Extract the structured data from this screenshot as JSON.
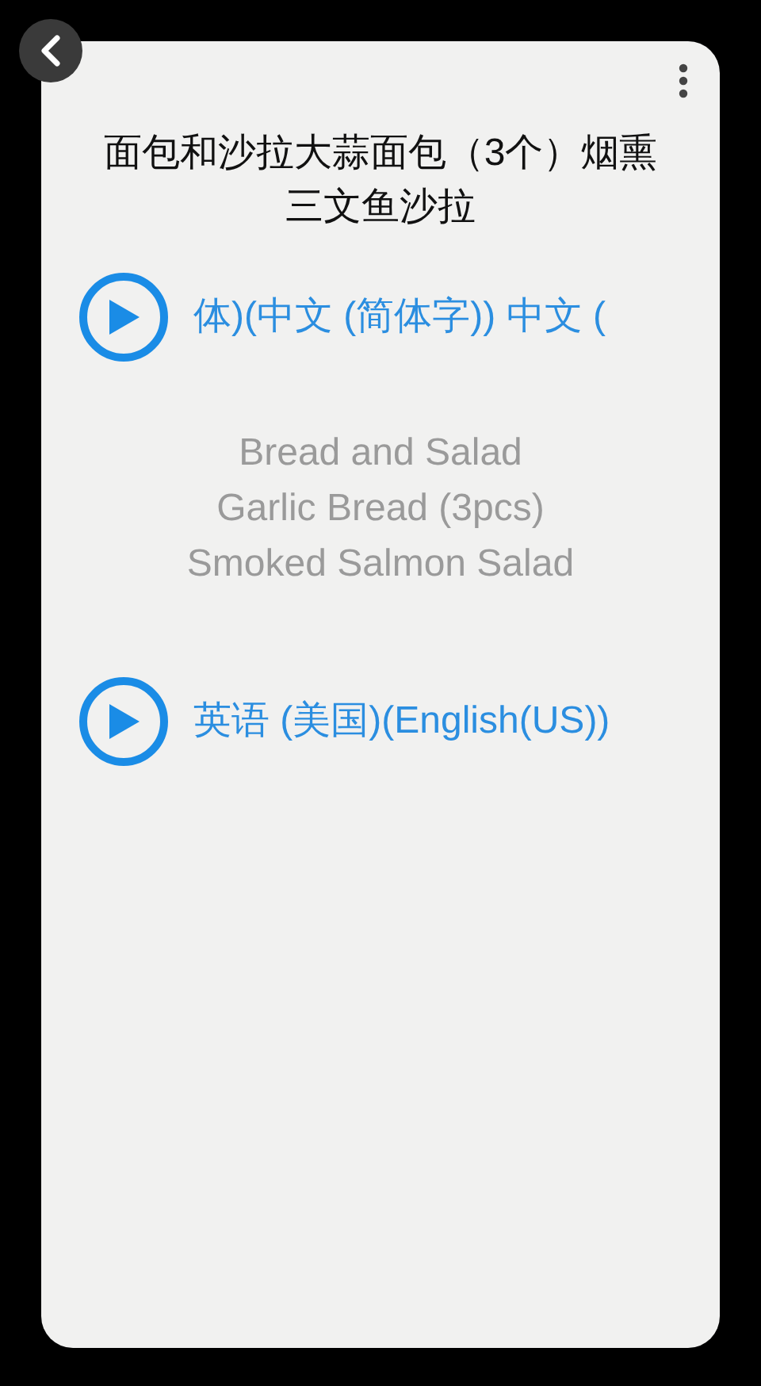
{
  "title": "面包和沙拉大蒜面包（3个）烟熏三文鱼沙拉",
  "players": [
    {
      "label": "体)(中文 (简体字))  中文 ("
    },
    {
      "label": "英语 (美国)(English(US))"
    }
  ],
  "translation_lines": [
    "Bread and Salad",
    "Garlic Bread (3pcs)",
    "Smoked Salmon Salad"
  ]
}
